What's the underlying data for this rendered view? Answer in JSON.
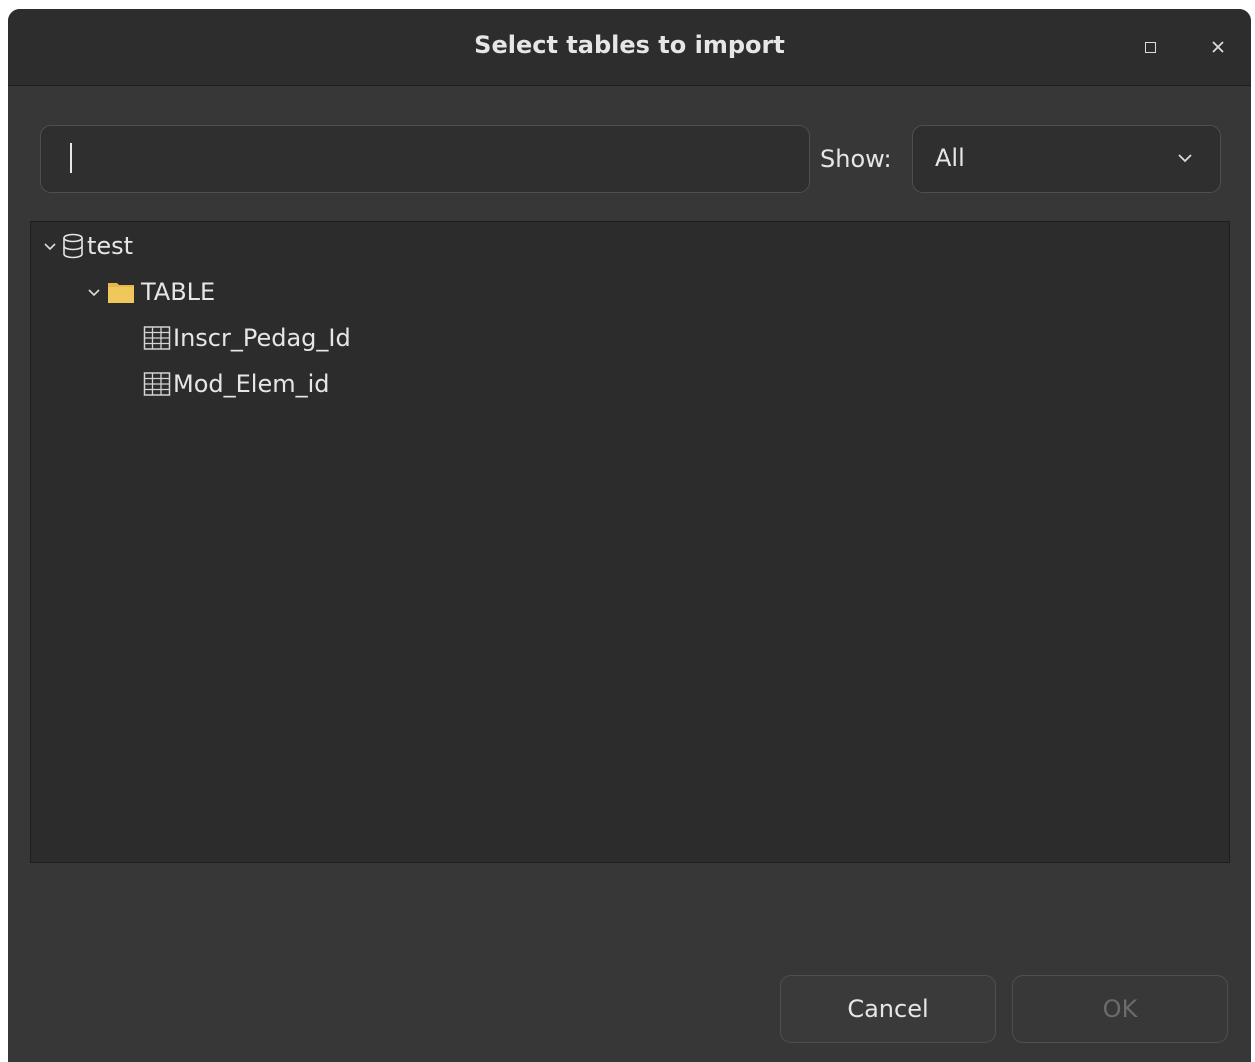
{
  "window": {
    "title": "Select tables to import"
  },
  "filter": {
    "search_value": "",
    "show_label": "Show:",
    "show_selected": "All"
  },
  "tree": {
    "database": {
      "label": "test",
      "icon": "database-icon",
      "expanded": true
    },
    "folder": {
      "label": "TABLE",
      "icon": "folder-icon",
      "color": "#e6b84a",
      "expanded": true
    },
    "tables": [
      {
        "label": "Inscr_Pedag_Id",
        "icon": "table-icon"
      },
      {
        "label": "Mod_Elem_id",
        "icon": "table-icon"
      }
    ]
  },
  "buttons": {
    "cancel_label": "Cancel",
    "ok_label": "OK",
    "ok_enabled": false
  },
  "colors": {
    "window_bg": "#373737",
    "titlebar_bg": "#2d2d2d",
    "tree_bg": "#2c2c2c",
    "text": "#e6e6e6",
    "disabled_text": "#6b6b6b"
  }
}
